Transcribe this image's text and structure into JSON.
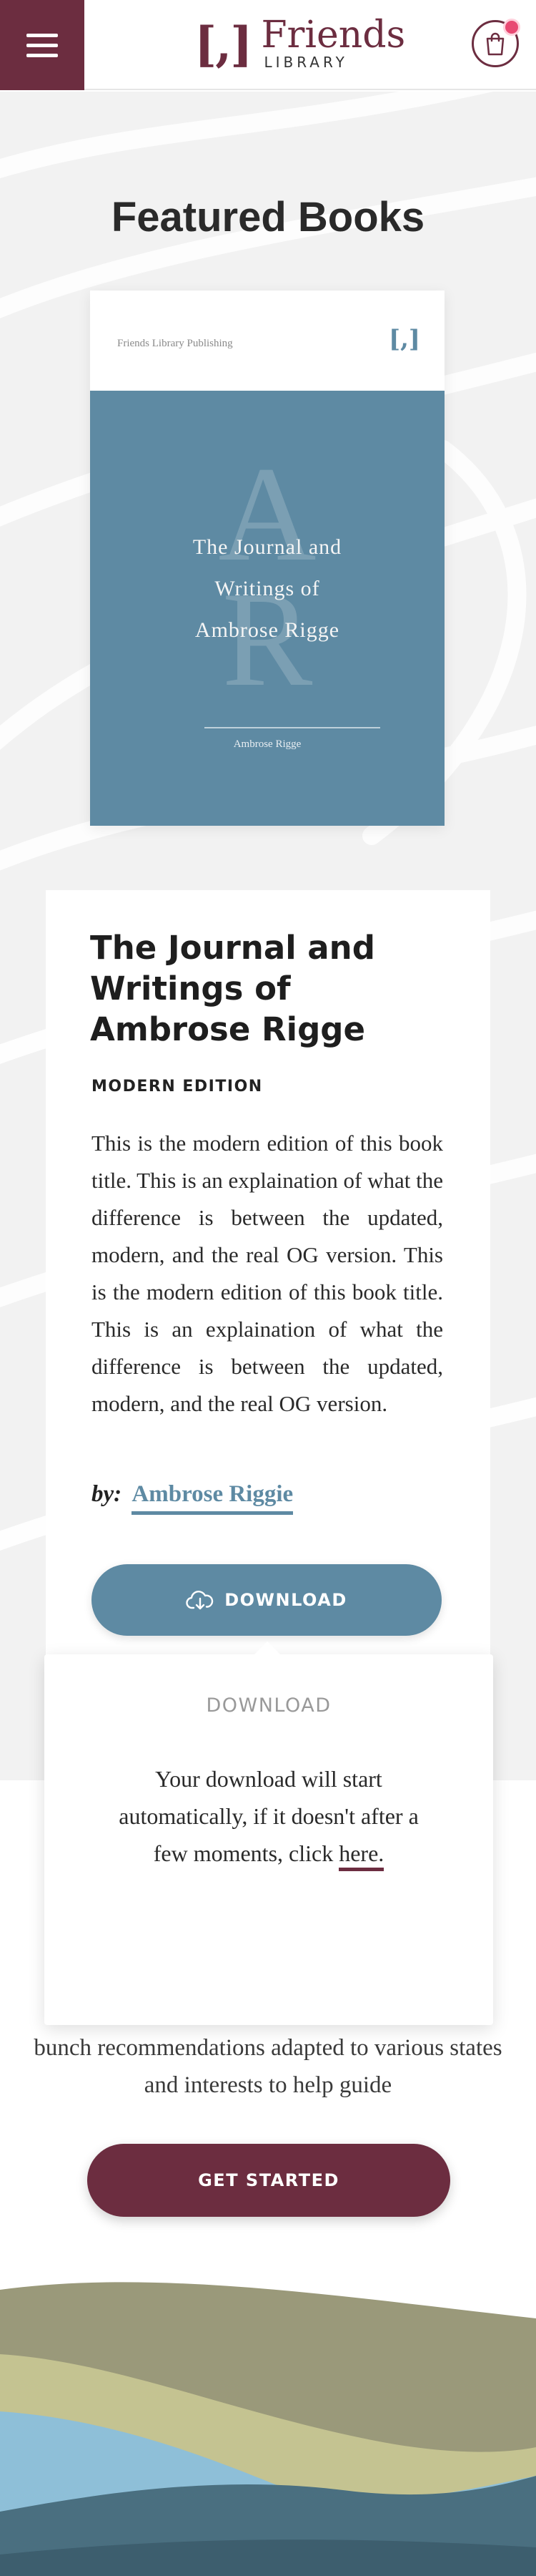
{
  "header": {
    "menu_icon": "hamburger-menu-icon",
    "logo_mark": "[,]",
    "logo_name": "Friends",
    "logo_sub": "LIBRARY",
    "cart_icon": "shopping-bag-icon"
  },
  "featured": {
    "title": "Featured Books"
  },
  "cover": {
    "publisher": "Friends Library Publishing",
    "mark": "[,]",
    "initials": [
      "A",
      "R"
    ],
    "title_lines": [
      "The Journal and",
      "Writings of",
      "Ambrose Rigge"
    ],
    "author": "Ambrose Rigge",
    "color": "#5e8aa3"
  },
  "book": {
    "title": "The Journal and Writings of Ambrose Rigge",
    "edition": "MODERN EDITION",
    "description": "This is the modern edition of this book title. This is an explaination of what the difference is between the updated, modern, and the real OG version. This is the modern edition of this book title. This is an explaination of what the difference is between the updated, modern, and the real OG version.",
    "by_label": "by:",
    "author_link": "Ambrose Riggie",
    "download_label": "DOWNLOAD",
    "download_icon": "cloud-download-icon"
  },
  "popup": {
    "title": "DOWNLOAD",
    "text_before": "Your download will start automatically, if it doesn't after a few moments, click",
    "link": "here."
  },
  "lower": {
    "text": "bunch recommendations adapted to various states and interests to help guide",
    "cta_label": "GET STARTED"
  },
  "colors": {
    "brand": "#6c2d40",
    "accent_blue": "#5e8aa3",
    "badge": "#e84a73"
  }
}
